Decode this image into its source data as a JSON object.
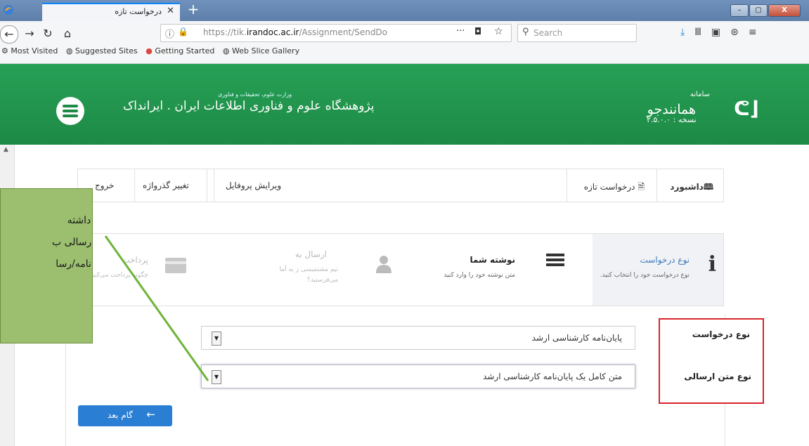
{
  "browser": {
    "tab_title": "درخواست تازه",
    "tab_close": "✕",
    "new_tab": "+",
    "url_prefix": "https://tik.",
    "url_host": "irandoc.ac.ir",
    "url_path": "/Assignment/SendDo",
    "url_more": "···",
    "search_placeholder": "Search",
    "window_buttons": [
      "–",
      "▢",
      "X"
    ],
    "bookmarks": [
      "Most Visited",
      "Suggested Sites",
      "Getting Started",
      "Web Slice Gallery"
    ]
  },
  "header": {
    "org_small": "وزارت علوم، تحقیقات و فناوری",
    "org_name": "پژوهشگاه علوم و فناوری اطلاعات ایران . ایرانداک",
    "app_small": "سامانه",
    "app_name": "همانندجو",
    "version": "نسخه : ۲.۵.۰.۰"
  },
  "nav": {
    "dashboard": "داشبورد",
    "new_request": "درخواست تازه",
    "edit_profile": "ویرایش پروفایل",
    "change_password": "تغییر گذرواژه",
    "logout": "خروج"
  },
  "steps": [
    {
      "title": "نوع درخواست",
      "desc": "نوع درخواست خود را انتخاب کنید."
    },
    {
      "title": "نوشته شما",
      "desc": "متن نوشته خود را وارد کنید"
    },
    {
      "title": "ارسال به",
      "desc": "نیم مشتمیسی ز به آما می‌فرستید؟"
    },
    {
      "title": "پرداخت",
      "desc": "چگونه پرداخت می‌کنید؟"
    }
  ],
  "form": {
    "type_label": "نوع درخواست",
    "type_value": "پایان‌نامه کارشناسی ارشد",
    "text_label": "نوع متن ارسالی",
    "text_value": "متن کامل یک پایان‌نامه کارشناسی ارشد",
    "next_button": "گام بعد"
  },
  "callout": {
    "lines": [
      "توجه داشته",
      "متن ارسالی ب",
      "پایان نامه/رسا"
    ]
  },
  "colors": {
    "header_green": "#1d8a45",
    "accent_blue": "#2a7fd4",
    "highlight_red": "#d9232a",
    "callout_green": "#9bbf6f"
  }
}
